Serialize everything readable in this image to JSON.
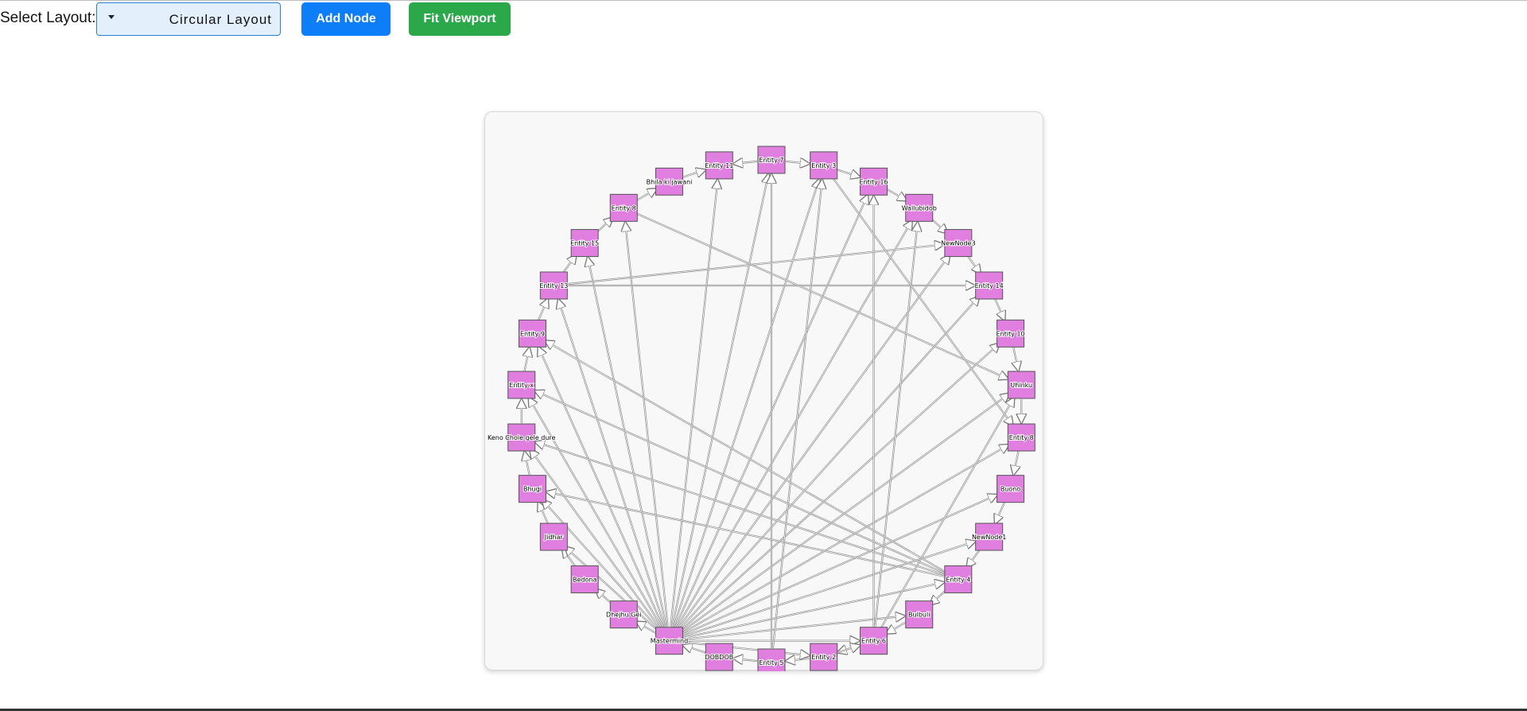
{
  "toolbar": {
    "layout_label": "Select Layout:",
    "layout_selected": "Circular Layout",
    "add_node_label": "Add Node",
    "fit_viewport_label": "Fit Viewport"
  },
  "colors": {
    "node_fill": "#e07fe0",
    "node_stroke": "#555555",
    "edge": "#8a8a8a",
    "add_button": "#0d7ef8",
    "fit_button": "#2ba84a"
  },
  "graph": {
    "layout": "circular",
    "nodes": [
      "Entity 7",
      "Entity 3",
      "Entity 16",
      "Wallubidob",
      "NewNode3",
      "Entity 14",
      "Entity 10",
      "Uhinku",
      "Entity 8",
      "Buono",
      "NewNode1",
      "Entity 4",
      "Bulbuli",
      "Entity 6",
      "Entity 2",
      "Entity 5",
      "DOBDOB",
      "Mastermind",
      "Dhejhu Gei",
      "Bedona",
      "Jidhar",
      "Bhugi",
      "Keno Chole gele dure",
      "Entity x",
      "Entity 9",
      "Entity 13",
      "Entity 15",
      "Entity 8",
      "Bhila ki jawani",
      "Entity 11"
    ],
    "edges": [
      [
        0,
        1
      ],
      [
        0,
        29
      ],
      [
        1,
        2
      ],
      [
        2,
        3
      ],
      [
        3,
        4
      ],
      [
        4,
        5
      ],
      [
        5,
        6
      ],
      [
        6,
        7
      ],
      [
        7,
        8
      ],
      [
        8,
        9
      ],
      [
        9,
        10
      ],
      [
        10,
        11
      ],
      [
        11,
        12
      ],
      [
        12,
        13
      ],
      [
        13,
        14
      ],
      [
        14,
        15
      ],
      [
        15,
        16
      ],
      [
        16,
        17
      ],
      [
        17,
        18
      ],
      [
        18,
        19
      ],
      [
        19,
        20
      ],
      [
        20,
        21
      ],
      [
        21,
        22
      ],
      [
        22,
        23
      ],
      [
        23,
        24
      ],
      [
        24,
        25
      ],
      [
        25,
        26
      ],
      [
        26,
        27
      ],
      [
        27,
        28
      ],
      [
        28,
        29
      ],
      [
        17,
        0
      ],
      [
        17,
        1
      ],
      [
        17,
        2
      ],
      [
        17,
        3
      ],
      [
        17,
        4
      ],
      [
        17,
        5
      ],
      [
        17,
        6
      ],
      [
        17,
        7
      ],
      [
        17,
        8
      ],
      [
        17,
        9
      ],
      [
        17,
        10
      ],
      [
        17,
        11
      ],
      [
        17,
        12
      ],
      [
        17,
        13
      ],
      [
        17,
        29
      ],
      [
        17,
        27
      ],
      [
        17,
        26
      ],
      [
        17,
        25
      ],
      [
        17,
        24
      ],
      [
        17,
        23
      ],
      [
        17,
        22
      ],
      [
        17,
        21
      ],
      [
        17,
        20
      ],
      [
        15,
        0
      ],
      [
        15,
        1
      ],
      [
        13,
        2
      ],
      [
        13,
        3
      ],
      [
        13,
        7
      ],
      [
        11,
        21
      ],
      [
        11,
        22
      ],
      [
        11,
        24
      ],
      [
        11,
        23
      ],
      [
        25,
        5
      ],
      [
        25,
        4
      ],
      [
        27,
        7
      ],
      [
        1,
        8
      ],
      [
        14,
        13
      ],
      [
        17,
        14
      ]
    ]
  }
}
